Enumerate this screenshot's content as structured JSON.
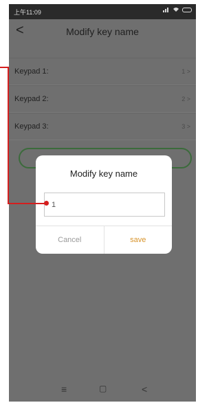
{
  "status_bar": {
    "time": "上午11:09"
  },
  "nav": {
    "back_icon": "chevron-left",
    "back_glyph": "<",
    "title": "Modify key name"
  },
  "keypads": [
    {
      "label": "Keypad 1:",
      "value": "1 >"
    },
    {
      "label": "Keypad 2:",
      "value": "2 >"
    },
    {
      "label": "Keypad 3:",
      "value": "3 >"
    }
  ],
  "dialog": {
    "title": "Modify key name",
    "input_value": "1",
    "cancel_label": "Cancel",
    "save_label": "save"
  },
  "bottom_nav": {
    "menu_glyph": "≡",
    "home_glyph": "▢",
    "back_glyph": "<"
  },
  "colors": {
    "overlay": "#6f6f6f",
    "status_bar": "#2a2a2a",
    "save": "#d8942c",
    "callout": "#d51e1e",
    "button_outline": "#3b6b3b"
  }
}
